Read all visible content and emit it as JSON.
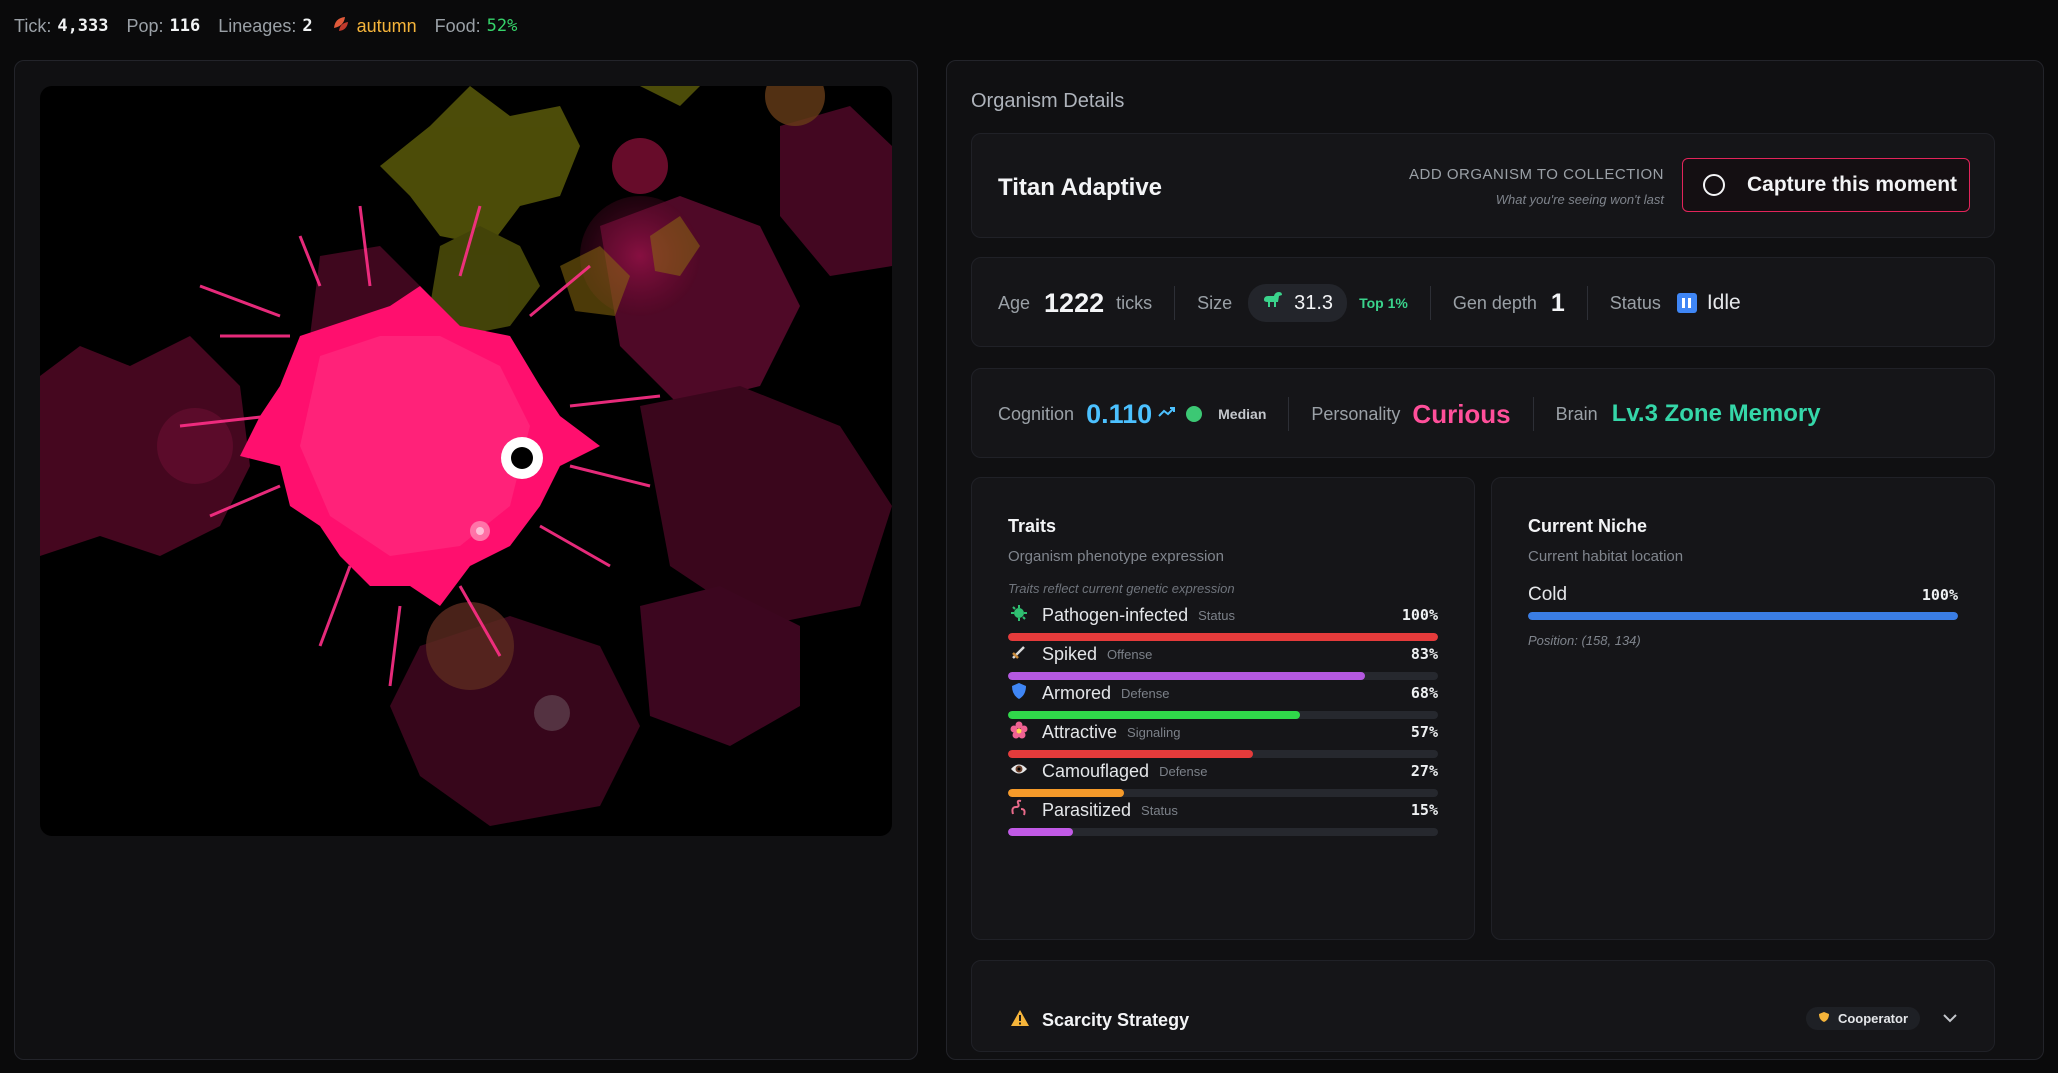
{
  "topbar": {
    "tick_label": "Tick:",
    "tick_value": "4,333",
    "pop_label": "Pop:",
    "pop_value": "116",
    "lineages_label": "Lineages:",
    "lineages_value": "2",
    "season_icon": "leaves-icon",
    "season": "autumn",
    "food_label": "Food:",
    "food_value": "52%"
  },
  "details": {
    "title": "Organism Details",
    "name": "Titan Adaptive",
    "collect_label": "ADD ORGANISM TO COLLECTION",
    "collect_sub": "What you're seeing won't last",
    "capture_label": "Capture this moment",
    "accent_color": "#e2245a"
  },
  "stats": {
    "age_label": "Age",
    "age_value": "1222",
    "age_unit": "ticks",
    "size_label": "Size",
    "size_icon": "dinosaur-icon",
    "size_value": "31.3",
    "size_rank": "Top 1%",
    "gen_label": "Gen depth",
    "gen_value": "1",
    "status_label": "Status",
    "status_icon": "pause-icon",
    "status_value": "Idle"
  },
  "brain": {
    "cognition_label": "Cognition",
    "cognition_value": "0.110",
    "cognition_trend_icon": "trend-up-icon",
    "cognition_rank": "Median",
    "personality_label": "Personality",
    "personality_value": "Curious",
    "brain_label": "Brain",
    "brain_value": "Lv.3 Zone Memory"
  },
  "traits": {
    "title": "Traits",
    "subtitle": "Organism phenotype expression",
    "note": "Traits reflect current genetic expression",
    "items": [
      {
        "icon": "microbe-icon",
        "name": "Pathogen-infected",
        "category": "Status",
        "pct": "100%",
        "value": 1.0,
        "color": "#e53b3b"
      },
      {
        "icon": "dagger-icon",
        "name": "Spiked",
        "category": "Offense",
        "pct": "83%",
        "value": 0.83,
        "color": "#b458e0"
      },
      {
        "icon": "shield-icon",
        "name": "Armored",
        "category": "Defense",
        "pct": "68%",
        "value": 0.68,
        "color": "#30d84a"
      },
      {
        "icon": "flower-icon",
        "name": "Attractive",
        "category": "Signaling",
        "pct": "57%",
        "value": 0.57,
        "color": "#e53b3b"
      },
      {
        "icon": "eye-icon",
        "name": "Camouflaged",
        "category": "Defense",
        "pct": "27%",
        "value": 0.27,
        "color": "#f59a2a"
      },
      {
        "icon": "worm-icon",
        "name": "Parasitized",
        "category": "Status",
        "pct": "15%",
        "value": 0.15,
        "color": "#c15ae6"
      }
    ]
  },
  "niche": {
    "title": "Current Niche",
    "subtitle": "Current habitat location",
    "name": "Cold",
    "pct": "100%",
    "value": 1.0,
    "position": "Position: (158, 134)"
  },
  "scarcity": {
    "icon": "warning-icon",
    "title": "Scarcity Strategy",
    "badge_icon": "shield-badge-icon",
    "badge": "Cooperator",
    "chevron_icon": "chevron-down-icon"
  }
}
